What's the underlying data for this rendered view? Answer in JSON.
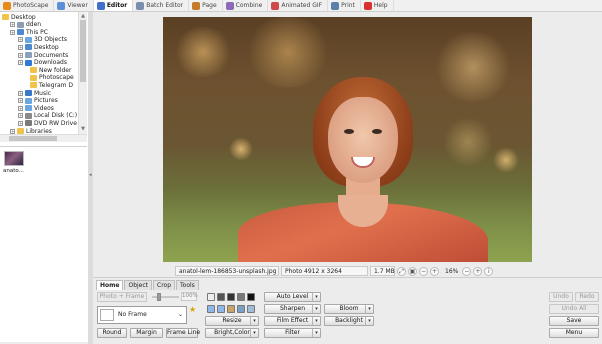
{
  "tabs": [
    {
      "label": "PhotoScape",
      "icon": "photoscape-icon",
      "color": "#e88a1a"
    },
    {
      "label": "Viewer",
      "icon": "viewer-icon",
      "color": "#5b8fd6"
    },
    {
      "label": "Editor",
      "icon": "editor-icon",
      "color": "#3f6fc9",
      "active": true
    },
    {
      "label": "Batch Editor",
      "icon": "batch-editor-icon",
      "color": "#7a8fb0"
    },
    {
      "label": "Page",
      "icon": "page-icon",
      "color": "#c47a2a"
    },
    {
      "label": "Combine",
      "icon": "combine-icon",
      "color": "#8b6bb8"
    },
    {
      "label": "Animated GIF",
      "icon": "animated-gif-icon",
      "color": "#d04a4a"
    },
    {
      "label": "Print",
      "icon": "print-icon",
      "color": "#5a7fa8"
    },
    {
      "label": "Help",
      "icon": "help-icon",
      "color": "#d9322c"
    }
  ],
  "tree": [
    {
      "label": "Desktop",
      "icon": "desktop-folder-icon",
      "color": "#f0c34a"
    },
    {
      "label": "dden",
      "icon": "user-icon",
      "color": "#8c9db3"
    },
    {
      "label": "This PC",
      "icon": "computer-icon",
      "color": "#4d88d0"
    },
    {
      "label": "3D Objects",
      "icon": "folder-icon",
      "color": "#6aa7e0"
    },
    {
      "label": "Desktop",
      "icon": "folder-icon",
      "color": "#4d88d0"
    },
    {
      "label": "Documents",
      "icon": "folder-icon",
      "color": "#8aa0bb"
    },
    {
      "label": "Downloads",
      "icon": "download-icon",
      "color": "#2f7bd6"
    },
    {
      "label": "New folder",
      "icon": "folder-icon",
      "color": "#f0c34a"
    },
    {
      "label": "Photoscape",
      "icon": "folder-icon",
      "color": "#f0c34a"
    },
    {
      "label": "Telegram D",
      "icon": "folder-icon",
      "color": "#f0c34a"
    },
    {
      "label": "Music",
      "icon": "music-icon",
      "color": "#3a77c9"
    },
    {
      "label": "Pictures",
      "icon": "folder-icon",
      "color": "#6aa7e0"
    },
    {
      "label": "Videos",
      "icon": "folder-icon",
      "color": "#6aa7e0"
    },
    {
      "label": "Local Disk (C:)",
      "icon": "disk-icon",
      "color": "#8a8a8a"
    },
    {
      "label": "DVD RW Drive",
      "icon": "dvd-icon",
      "color": "#7a7a7a"
    },
    {
      "label": "Libraries",
      "icon": "folder-icon",
      "color": "#f0c34a"
    }
  ],
  "thumbnail": {
    "label": "anato..."
  },
  "status": {
    "filename": "anatol-lem-186853-unsplash.jpg",
    "dimensions": "Photo 4912 x 3264",
    "filesize": "1.7 MB",
    "zoom": "16%"
  },
  "editor_tabs": [
    "Home",
    "Object",
    "Crop",
    "Tools"
  ],
  "editor": {
    "photo_frame": "Photo + Frame",
    "opacity": "100%",
    "frame_value": "No Frame",
    "round": "Round",
    "margin": "Margin",
    "frame_line": "Frame Line",
    "auto_level": "Auto Level",
    "sharpen": "Sharpen",
    "film_effect": "Film Effect",
    "resize": "Resize",
    "bright_color": "Bright,Color",
    "filter": "Filter",
    "bloom": "Bloom",
    "backlight": "Backlight",
    "undo": "Undo",
    "redo": "Redo",
    "undo_all": "Undo All",
    "save": "Save",
    "menu": "Menu"
  }
}
